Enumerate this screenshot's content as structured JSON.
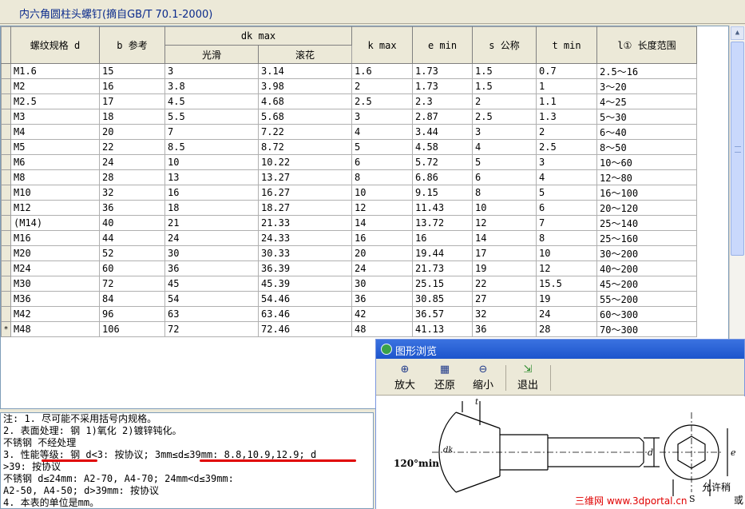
{
  "window": {
    "title": "内六角圆柱头螺钉(摘自GB/T 70.1-2000)"
  },
  "table": {
    "headers": {
      "spec": "螺纹规格 d",
      "b": "b 参考",
      "dk": "dk max",
      "dk_smooth": "光滑",
      "dk_knurl": "滚花",
      "k": "k max",
      "e": "e min",
      "s": "s 公称",
      "t": "t min",
      "l": "l① 长度范围"
    },
    "rows": [
      {
        "ind": "",
        "d": "M1.6",
        "b": "15",
        "dk1": "3",
        "dk2": "3.14",
        "k": "1.6",
        "e": "1.73",
        "s": "1.5",
        "t": "0.7",
        "l": "2.5～16"
      },
      {
        "ind": "",
        "d": "M2",
        "b": "16",
        "dk1": "3.8",
        "dk2": "3.98",
        "k": "2",
        "e": "1.73",
        "s": "1.5",
        "t": "1",
        "l": "3～20"
      },
      {
        "ind": "",
        "d": "M2.5",
        "b": "17",
        "dk1": "4.5",
        "dk2": "4.68",
        "k": "2.5",
        "e": "2.3",
        "s": "2",
        "t": "1.1",
        "l": "4～25"
      },
      {
        "ind": "",
        "d": "M3",
        "b": "18",
        "dk1": "5.5",
        "dk2": "5.68",
        "k": "3",
        "e": "2.87",
        "s": "2.5",
        "t": "1.3",
        "l": "5～30"
      },
      {
        "ind": "",
        "d": "M4",
        "b": "20",
        "dk1": "7",
        "dk2": "7.22",
        "k": "4",
        "e": "3.44",
        "s": "3",
        "t": "2",
        "l": "6～40"
      },
      {
        "ind": "",
        "d": "M5",
        "b": "22",
        "dk1": "8.5",
        "dk2": "8.72",
        "k": "5",
        "e": "4.58",
        "s": "4",
        "t": "2.5",
        "l": "8～50"
      },
      {
        "ind": "",
        "d": "M6",
        "b": "24",
        "dk1": "10",
        "dk2": "10.22",
        "k": "6",
        "e": "5.72",
        "s": "5",
        "t": "3",
        "l": "10～60"
      },
      {
        "ind": "",
        "d": "M8",
        "b": "28",
        "dk1": "13",
        "dk2": "13.27",
        "k": "8",
        "e": "6.86",
        "s": "6",
        "t": "4",
        "l": "12～80"
      },
      {
        "ind": "",
        "d": "M10",
        "b": "32",
        "dk1": "16",
        "dk2": "16.27",
        "k": "10",
        "e": "9.15",
        "s": "8",
        "t": "5",
        "l": "16～100"
      },
      {
        "ind": "",
        "d": "M12",
        "b": "36",
        "dk1": "18",
        "dk2": "18.27",
        "k": "12",
        "e": "11.43",
        "s": "10",
        "t": "6",
        "l": "20～120"
      },
      {
        "ind": "",
        "d": "(M14)",
        "b": "40",
        "dk1": "21",
        "dk2": "21.33",
        "k": "14",
        "e": "13.72",
        "s": "12",
        "t": "7",
        "l": "25～140"
      },
      {
        "ind": "",
        "d": "M16",
        "b": "44",
        "dk1": "24",
        "dk2": "24.33",
        "k": "16",
        "e": "16",
        "s": "14",
        "t": "8",
        "l": "25～160"
      },
      {
        "ind": "",
        "d": "M20",
        "b": "52",
        "dk1": "30",
        "dk2": "30.33",
        "k": "20",
        "e": "19.44",
        "s": "17",
        "t": "10",
        "l": "30～200"
      },
      {
        "ind": "",
        "d": "M24",
        "b": "60",
        "dk1": "36",
        "dk2": "36.39",
        "k": "24",
        "e": "21.73",
        "s": "19",
        "t": "12",
        "l": "40～200"
      },
      {
        "ind": "",
        "d": "M30",
        "b": "72",
        "dk1": "45",
        "dk2": "45.39",
        "k": "30",
        "e": "25.15",
        "s": "22",
        "t": "15.5",
        "l": "45～200"
      },
      {
        "ind": "",
        "d": "M36",
        "b": "84",
        "dk1": "54",
        "dk2": "54.46",
        "k": "36",
        "e": "30.85",
        "s": "27",
        "t": "19",
        "l": "55～200"
      },
      {
        "ind": "",
        "d": "M42",
        "b": "96",
        "dk1": "63",
        "dk2": "63.46",
        "k": "42",
        "e": "36.57",
        "s": "32",
        "t": "24",
        "l": "60～300"
      },
      {
        "ind": "*",
        "d": "M48",
        "b": "106",
        "dk1": "72",
        "dk2": "72.46",
        "k": "48",
        "e": "41.13",
        "s": "36",
        "t": "28",
        "l": "70～300"
      }
    ]
  },
  "notes": {
    "lines": [
      "注: 1. 尽可能不采用括号内规格。",
      "    2. 表面处理: 钢  1)氧化 2)镀锌钝化。",
      "                 不锈钢  不经处理",
      "    3. 性能等级: 钢  d<3: 按协议; 3mm≤d≤39mm: 8.8,10.9,12.9; d",
      ">39: 按协议",
      "                 不锈钢   d≤24mm: A2-70, A4-70; 24mm<d≤39mm:",
      "A2-50, A4-50; d>39mm: 按协议",
      "    4. 本表的单位是mm。"
    ]
  },
  "preview": {
    "title": "图形浏览",
    "buttons": {
      "zoom_in": "放大",
      "restore": "还原",
      "zoom_out": "缩小",
      "exit": "退出"
    },
    "drawing": {
      "angle_label": "120°min",
      "dk": "dk",
      "d": "d",
      "e": "e",
      "s": "S",
      "t": "t",
      "note": "允许稍",
      "note2": "或"
    }
  },
  "watermark": "三维网 www.3dportal.cn"
}
